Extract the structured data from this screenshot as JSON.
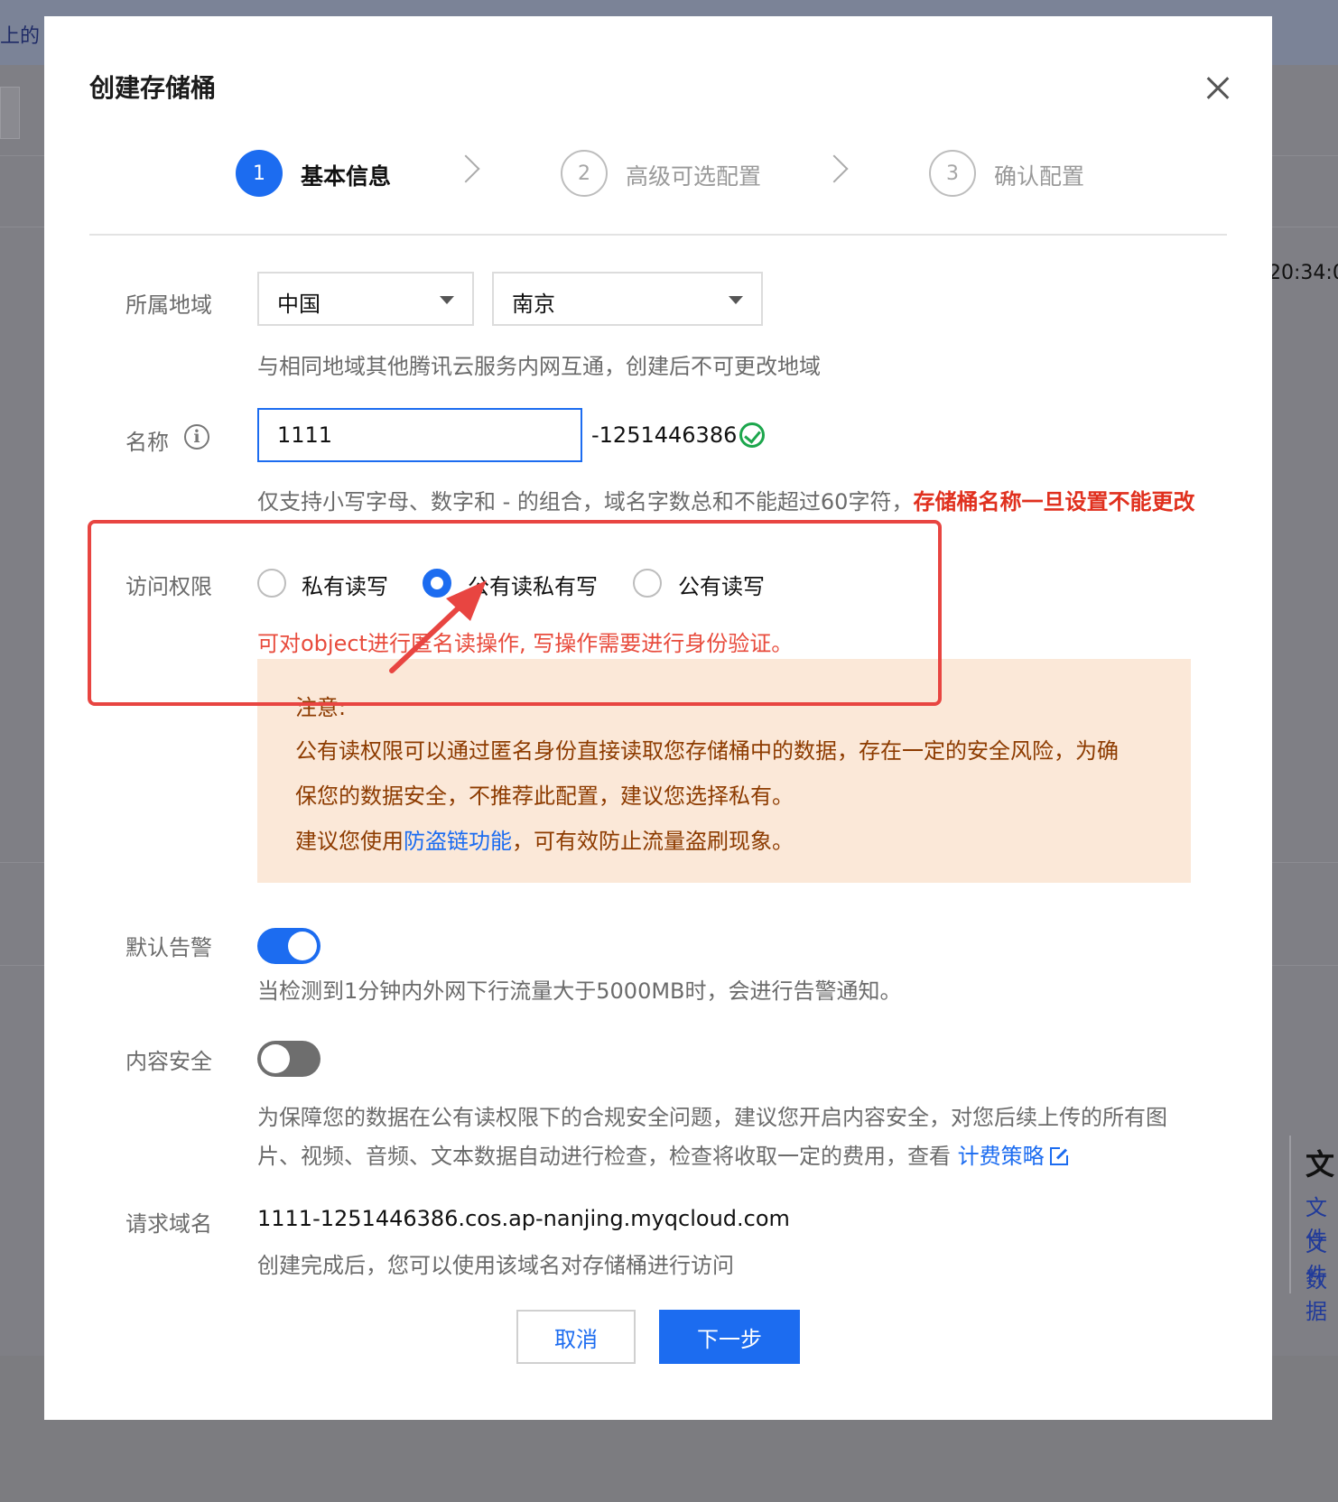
{
  "background": {
    "left_text": "上的",
    "time_text": "20:34:0",
    "card": {
      "title": "文",
      "links": [
        "文件",
        "文件",
        "数据"
      ]
    }
  },
  "dialog": {
    "title": "创建存储桶",
    "steps": [
      {
        "num": "1",
        "label": "基本信息",
        "active": true
      },
      {
        "num": "2",
        "label": "高级可选配置",
        "active": false
      },
      {
        "num": "3",
        "label": "确认配置",
        "active": false
      }
    ],
    "region": {
      "label": "所属地域",
      "country": "中国",
      "city": "南京",
      "help": "与相同地域其他腾讯云服务内网互通，创建后不可更改地域"
    },
    "name": {
      "label": "名称",
      "value": "1111",
      "suffix": "-1251446386",
      "help": "仅支持小写字母、数字和 - 的组合，域名字数总和不能超过60字符，",
      "warning": "存储桶名称一旦设置不能更改"
    },
    "access": {
      "label": "访问权限",
      "options": [
        "私有读写",
        "公有读私有写",
        "公有读写"
      ],
      "selected_index": 1,
      "description": "可对object进行匿名读操作, 写操作需要进行身份验证。",
      "notice": {
        "title": "注意:",
        "line1": "公有读权限可以通过匿名身份直接读取您存储桶中的数据，存在一定的安全风险，为确",
        "line2": "保您的数据安全，不推荐此配置，建议您选择私有。",
        "line3_prefix": "建议您使用",
        "line3_link": "防盗链功能",
        "line3_suffix": "，可有效防止流量盗刷现象。"
      }
    },
    "alarm": {
      "label": "默认告警",
      "enabled": true,
      "help": "当检测到1分钟内外网下行流量大于5000MB时，会进行告警通知。"
    },
    "content_security": {
      "label": "内容安全",
      "enabled": false,
      "help_line1": "为保障您的数据在公有读权限下的合规安全问题，建议您开启内容安全，对您后续上传的所有图",
      "help_line2_prefix": "片、视频、音频、文本数据自动进行检查，检查将收取一定的费用，查看",
      "help_link": "计费策略"
    },
    "domain": {
      "label": "请求域名",
      "value": "1111-1251446386.cos.ap-nanjing.myqcloud.com",
      "help": "创建完成后，您可以使用该域名对存储桶进行访问"
    },
    "buttons": {
      "cancel": "取消",
      "next": "下一步"
    }
  },
  "colors": {
    "primary": "#1c6cf0",
    "danger": "#e0301e",
    "annotation": "#e84541",
    "notice_bg": "#fbe8d8",
    "notice_text": "#8d3b00",
    "success": "#1ca64c"
  },
  "icons": [
    "close-icon",
    "info-icon",
    "check-circle-icon",
    "chevron-right-icon",
    "caret-down-icon",
    "external-link-icon"
  ]
}
